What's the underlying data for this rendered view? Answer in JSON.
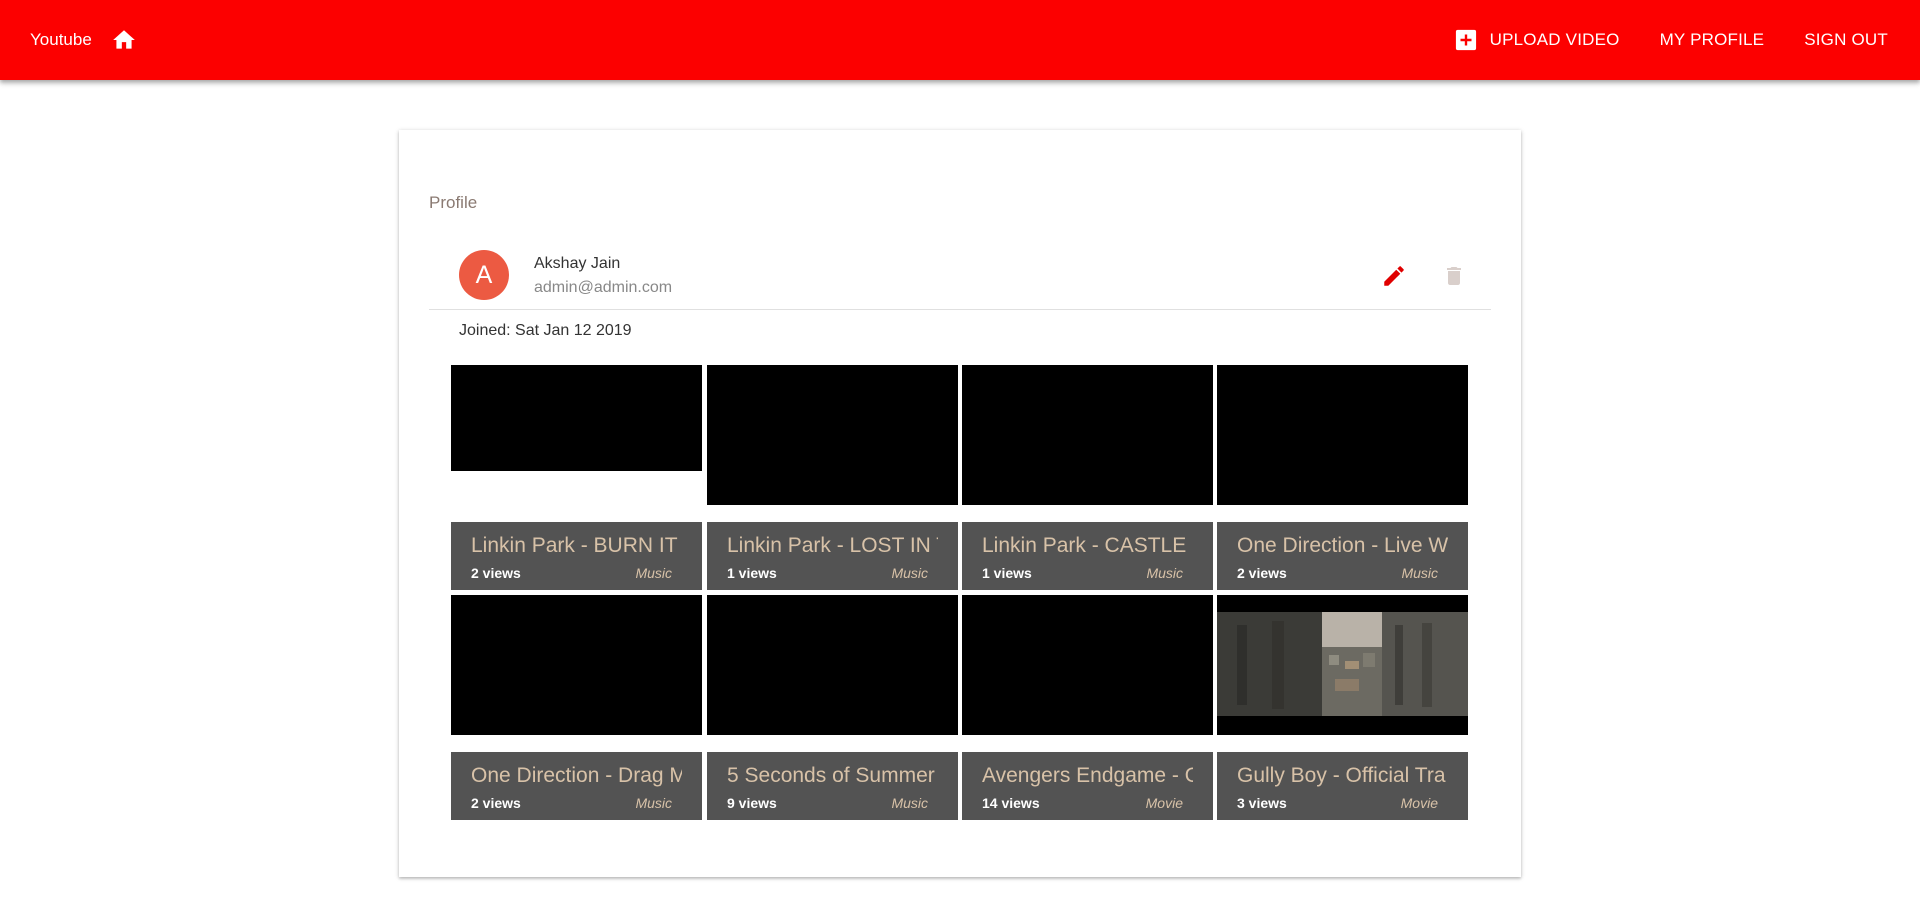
{
  "appbar": {
    "brand": "Youtube",
    "upload_label": "UPLOAD VIDEO",
    "profile_label": "MY PROFILE",
    "signout_label": "SIGN OUT"
  },
  "profile": {
    "title": "Profile",
    "avatar_letter": "A",
    "name": "Akshay Jain",
    "email": "admin@admin.com",
    "joined": "Joined: Sat Jan 12 2019"
  },
  "videos": [
    {
      "title": "Linkin Park - BURN IT",
      "views": "2 views",
      "category": "Music"
    },
    {
      "title": "Linkin Park - LOST IN T",
      "views": "1 views",
      "category": "Music"
    },
    {
      "title": "Linkin Park - CASTLE",
      "views": "1 views",
      "category": "Music"
    },
    {
      "title": "One Direction - Live W",
      "views": "2 views",
      "category": "Music"
    },
    {
      "title": "One Direction - Drag M",
      "views": "2 views",
      "category": "Music"
    },
    {
      "title": "5 Seconds of Summer",
      "views": "9 views",
      "category": "Music"
    },
    {
      "title": "Avengers Endgame - O",
      "views": "14 views",
      "category": "Movie"
    },
    {
      "title": "Gully Boy - Official Tra",
      "views": "3 views",
      "category": "Movie"
    }
  ],
  "colors": {
    "appbar": "#fc0000",
    "avatar": "#ec5a42",
    "edit_icon": "#e00000",
    "delete_icon": "#d9cfcb",
    "tile_bar": "#505050",
    "tile_title": "#d8c2a8"
  },
  "icons": {
    "home": "home-icon",
    "upload": "add-box-icon",
    "edit": "pencil-icon",
    "delete": "trash-icon"
  }
}
